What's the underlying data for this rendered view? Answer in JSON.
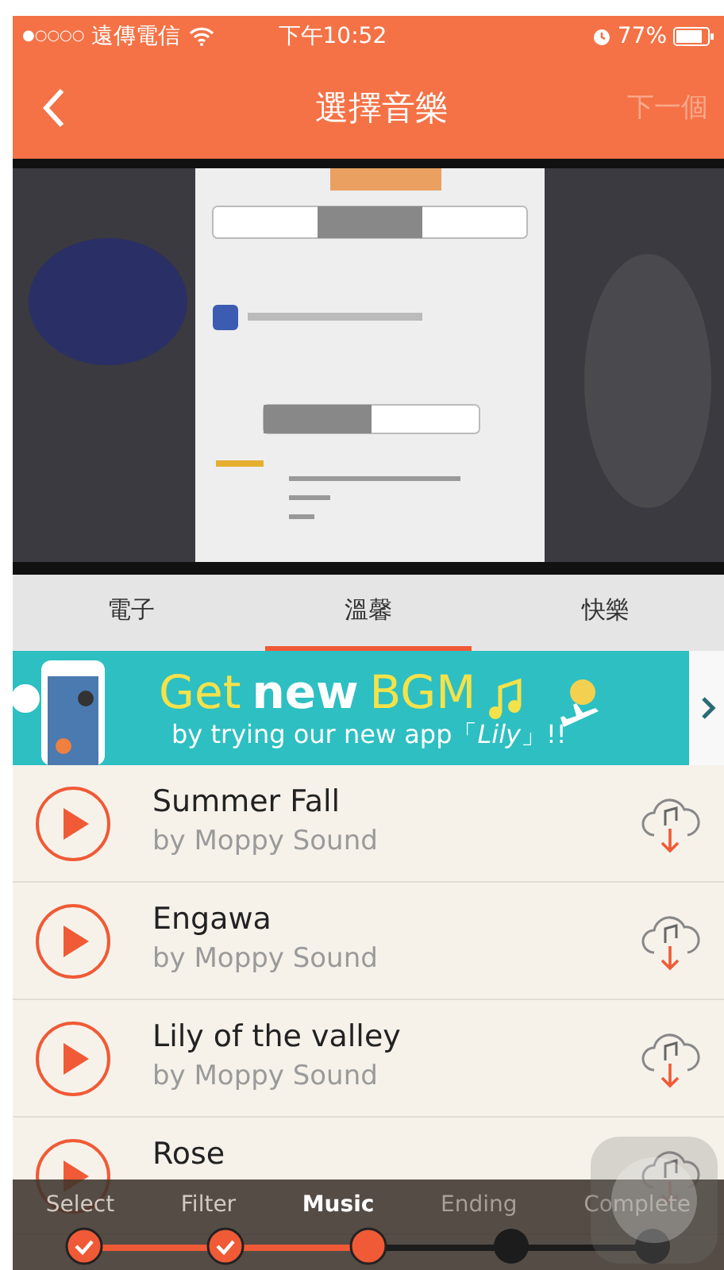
{
  "status_bar": {
    "signal": "●○○○○",
    "carrier": "遠傳電信",
    "time": "下午10:52",
    "battery": "77%"
  },
  "nav": {
    "title": "選擇音樂",
    "next": {
      "label": "下一個",
      "disabled": true
    }
  },
  "tabs": [
    {
      "label": "電子",
      "selected": false
    },
    {
      "label": "溫馨",
      "selected": true
    },
    {
      "label": "快樂",
      "selected": false
    }
  ],
  "banner": {
    "headline_1": "Get",
    "headline_2": "new",
    "headline_3": "BGM",
    "subline": "by trying our new app「*Lily*」!!"
  },
  "tracks": [
    {
      "title": "Summer Fall",
      "artist": "by Moppy Sound"
    },
    {
      "title": "Engawa",
      "artist": "by Moppy Sound"
    },
    {
      "title": "Lily of the valley",
      "artist": "by Moppy Sound"
    },
    {
      "title": "Rose"
    }
  ],
  "steps": [
    {
      "label": "Select",
      "completed": true,
      "selected": false
    },
    {
      "label": "Filter",
      "completed": true,
      "selected": false
    },
    {
      "label": "Music",
      "completed": false,
      "selected": true
    },
    {
      "label": "Ending",
      "completed": false,
      "selected": false
    },
    {
      "label": "Complete",
      "completed": false,
      "selected": false
    }
  ]
}
